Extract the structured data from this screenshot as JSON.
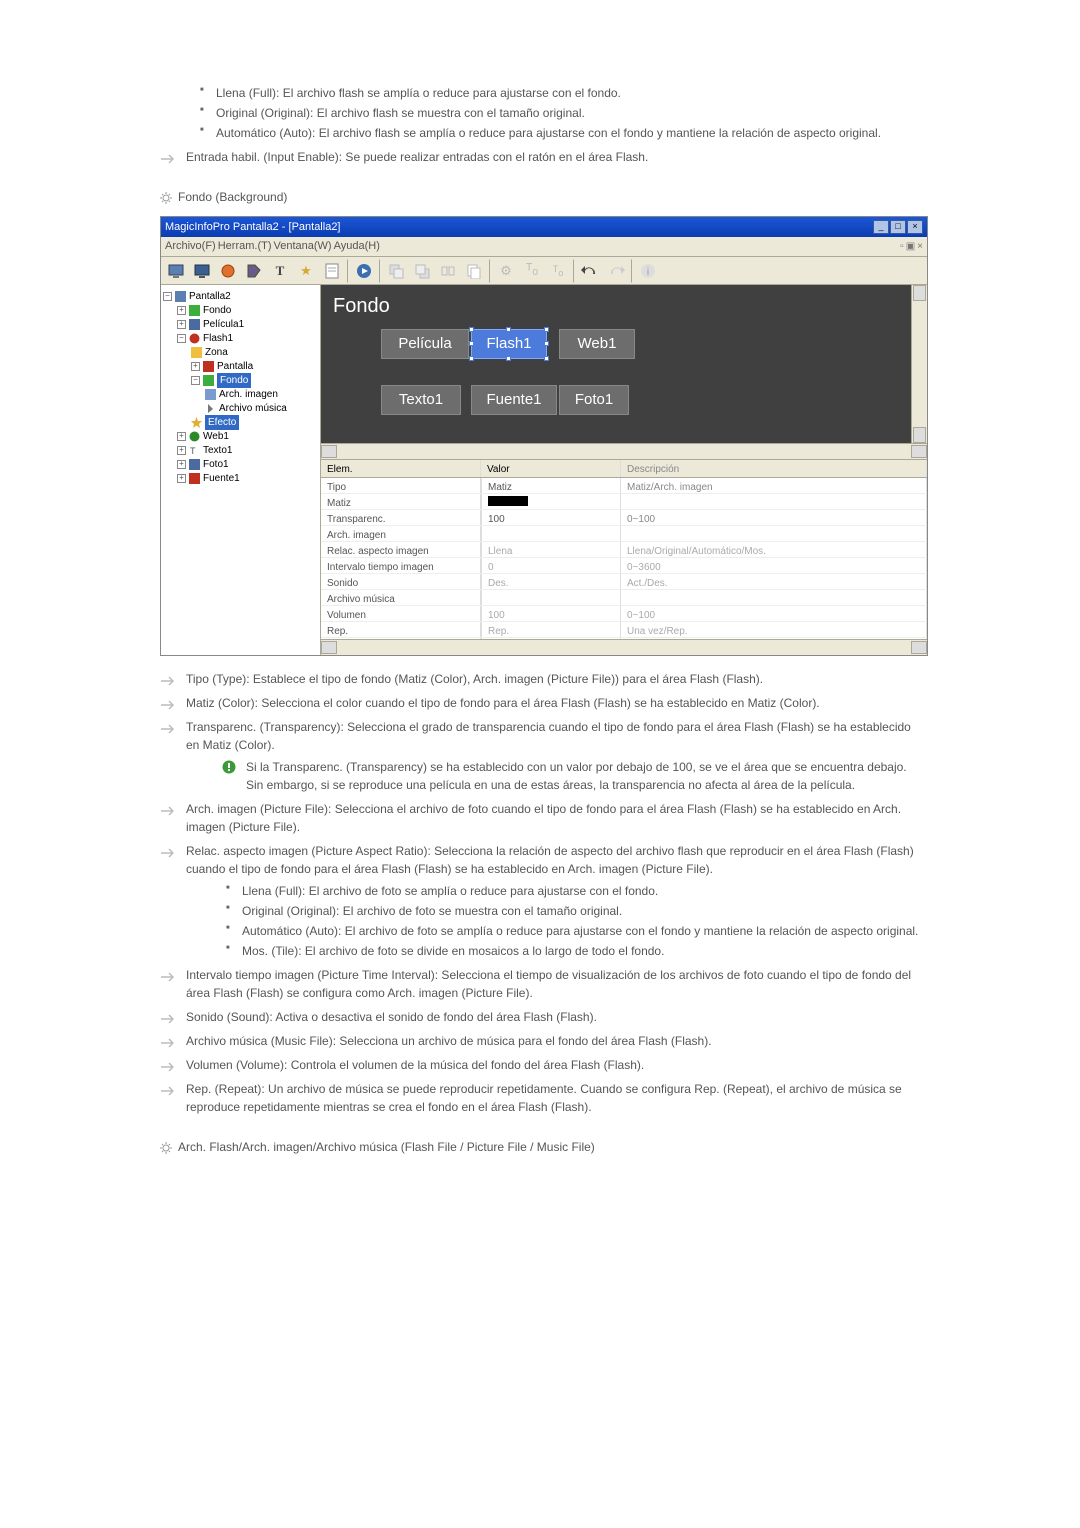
{
  "intro_items": [
    "Llena (Full): El archivo flash se amplía o reduce para ajustarse con el fondo.",
    "Original (Original): El archivo flash se muestra con el tamaño original.",
    "Automático (Auto): El archivo flash se amplía o reduce para ajustarse con el fondo y mantiene la relación de aspecto original."
  ],
  "entrada_habil": "Entrada habil. (Input Enable): Se puede realizar entradas con el ratón en el área Flash.",
  "section_fondo": "Fondo (Background)",
  "app": {
    "title": "MagicInfoPro Pantalla2 - [Pantalla2]",
    "menus": [
      "Archivo(F)",
      "Herram.(T)",
      "Ventana(W)",
      "Ayuda(H)"
    ],
    "tree": {
      "root": "Pantalla2",
      "items": [
        "Fondo",
        "Película1",
        "Flash1"
      ],
      "flash_children": [
        "Zona",
        "Pantalla",
        "Fondo"
      ],
      "fondo_children": [
        "Arch. imagen",
        "Archivo música"
      ],
      "efecto": "Efecto",
      "rest": [
        "Web1",
        "Texto1",
        "Foto1",
        "Fuente1"
      ]
    },
    "canvas": {
      "label": "Fondo",
      "tiles_row1": [
        "Película",
        "Flash1",
        "Web1"
      ],
      "tiles_row2": [
        "Texto1",
        "Fuente1",
        "Foto1"
      ]
    },
    "props": {
      "head": [
        "Elem.",
        "Valor",
        "Descripción"
      ],
      "rows": [
        {
          "e": "Tipo",
          "v": "Matiz",
          "d": "Matiz/Arch. imagen"
        },
        {
          "e": "Matiz",
          "v": "__swatch__",
          "d": ""
        },
        {
          "e": "Transparenc.",
          "v": "100",
          "d": "0~100"
        },
        {
          "e": "Arch. imagen",
          "v": "",
          "d": ""
        },
        {
          "e": "Relac. aspecto imagen",
          "v": "Llena",
          "d": "Llena/Original/Automático/Mos.",
          "muted": true
        },
        {
          "e": "Intervalo tiempo imagen",
          "v": "0",
          "d": "0~3600",
          "muted": true
        },
        {
          "e": "Sonido",
          "v": "Des.",
          "d": "Act./Des.",
          "muted": true
        },
        {
          "e": "Archivo música",
          "v": "",
          "d": ""
        },
        {
          "e": "Volumen",
          "v": "100",
          "d": "0~100",
          "muted": true
        },
        {
          "e": "Rep.",
          "v": "Rep.",
          "d": "Una vez/Rep.",
          "muted": true
        }
      ]
    }
  },
  "after_list": [
    {
      "text": "Tipo (Type): Establece el tipo de fondo (Matiz (Color), Arch. imagen (Picture File)) para el área Flash (Flash)."
    },
    {
      "text": "Matiz (Color): Selecciona el color cuando el tipo de fondo para el área Flash (Flash) se ha establecido en Matiz (Color)."
    },
    {
      "text": "Transparenc. (Transparency): Selecciona el grado de transparencia cuando el tipo de fondo para el área Flash (Flash) se ha establecido en Matiz (Color).",
      "note": "Si la Transparenc. (Transparency) se ha establecido con un valor por debajo de 100, se ve el área que se encuentra debajo. Sin embargo, si se reproduce una película en una de estas áreas, la transparencia no afecta al área de la película."
    },
    {
      "text": "Arch. imagen (Picture File): Selecciona el archivo de foto cuando el tipo de fondo para el área Flash (Flash) se ha establecido en Arch. imagen (Picture File)."
    },
    {
      "text": "Relac. aspecto imagen (Picture Aspect Ratio): Selecciona la relación de aspecto del archivo flash que reproducir en el área Flash (Flash) cuando el tipo de fondo para el área Flash (Flash) se ha establecido en Arch. imagen (Picture File).",
      "sub": [
        "Llena (Full): El archivo de foto se amplía o reduce para ajustarse con el fondo.",
        "Original (Original): El archivo de foto se muestra con el tamaño original.",
        "Automático (Auto): El archivo de foto se amplía o reduce para ajustarse con el fondo y mantiene la relación de aspecto original.",
        "Mos. (Tile): El archivo de foto se divide en mosaicos a lo largo de todo el fondo."
      ]
    },
    {
      "text": "Intervalo tiempo imagen (Picture Time Interval): Selecciona el tiempo de visualización de los archivos de foto cuando el tipo de fondo del área Flash (Flash) se configura como Arch. imagen (Picture File)."
    },
    {
      "text": "Sonido (Sound): Activa o desactiva el sonido de fondo del área Flash (Flash)."
    },
    {
      "text": "Archivo música (Music File): Selecciona un archivo de música para el fondo del área Flash (Flash)."
    },
    {
      "text": "Volumen (Volume): Controla el volumen de la música del fondo del área Flash (Flash)."
    },
    {
      "text": "Rep. (Repeat): Un archivo de música se puede reproducir repetidamente. Cuando se configura Rep. (Repeat), el archivo de música se reproduce repetidamente mientras se crea el fondo en el área Flash (Flash)."
    }
  ],
  "section_arch": "Arch. Flash/Arch. imagen/Archivo música (Flash File / Picture File / Music File)"
}
